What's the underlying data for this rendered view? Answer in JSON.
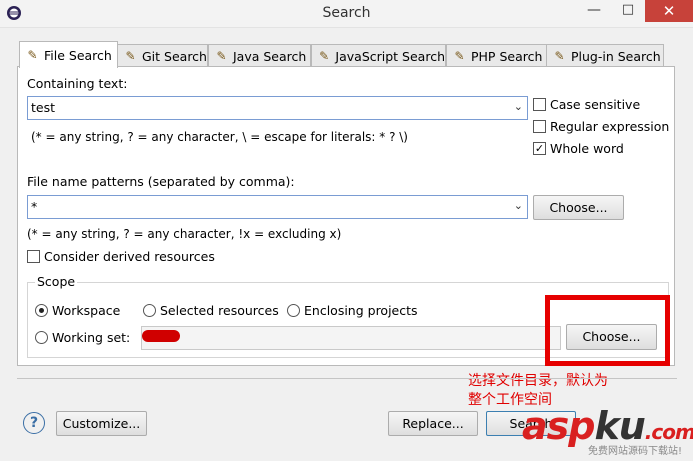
{
  "window": {
    "title": "Search",
    "minimize": "—",
    "maximize": "□",
    "close": "✕"
  },
  "tabs": [
    {
      "label": "File Search",
      "icon": "flashlight-icon"
    },
    {
      "label": "Git Search",
      "icon": "git-icon"
    },
    {
      "label": "Java Search",
      "icon": "java-icon"
    },
    {
      "label": "JavaScript Search",
      "icon": "javascript-icon"
    },
    {
      "label": "PHP Search",
      "icon": "php-icon"
    },
    {
      "label": "Plug-in Search",
      "icon": "plugin-icon"
    }
  ],
  "containing": {
    "label": "Containing text:",
    "value": "test",
    "hint": "(* = any string, ? = any character, \\ = escape for literals: * ? \\)"
  },
  "options": {
    "case_sensitive": {
      "label": "Case sensitive",
      "checked": false
    },
    "regex": {
      "label": "Regular expression",
      "checked": false
    },
    "whole_word": {
      "label": "Whole word",
      "checked": true
    }
  },
  "file_patterns": {
    "label": "File name patterns (separated by comma):",
    "value": "*",
    "hint": "(* = any string, ? = any character, !x = excluding x)",
    "choose": "Choose..."
  },
  "derived": {
    "label": "Consider derived resources",
    "checked": false
  },
  "scope": {
    "label": "Scope",
    "workspace": "Workspace",
    "selected": "Selected resources",
    "enclosing": "Enclosing projects",
    "working_set": "Working set:",
    "choose": "Choose...",
    "selected_option": "workspace"
  },
  "annotation": {
    "line1": "选择文件目录，默认为",
    "line2": "整个工作空间"
  },
  "footer": {
    "help": "?",
    "customize": "Customize...",
    "replace": "Replace...",
    "search": "Search"
  },
  "watermark": {
    "brand_a": "asp",
    "brand_b": "ku",
    "brand_c": ".com",
    "sub": "免费网站源码下载站!"
  },
  "colors": {
    "accent": "#7a9cd3",
    "annotation": "#e00000",
    "close_button": "#c7423a"
  }
}
